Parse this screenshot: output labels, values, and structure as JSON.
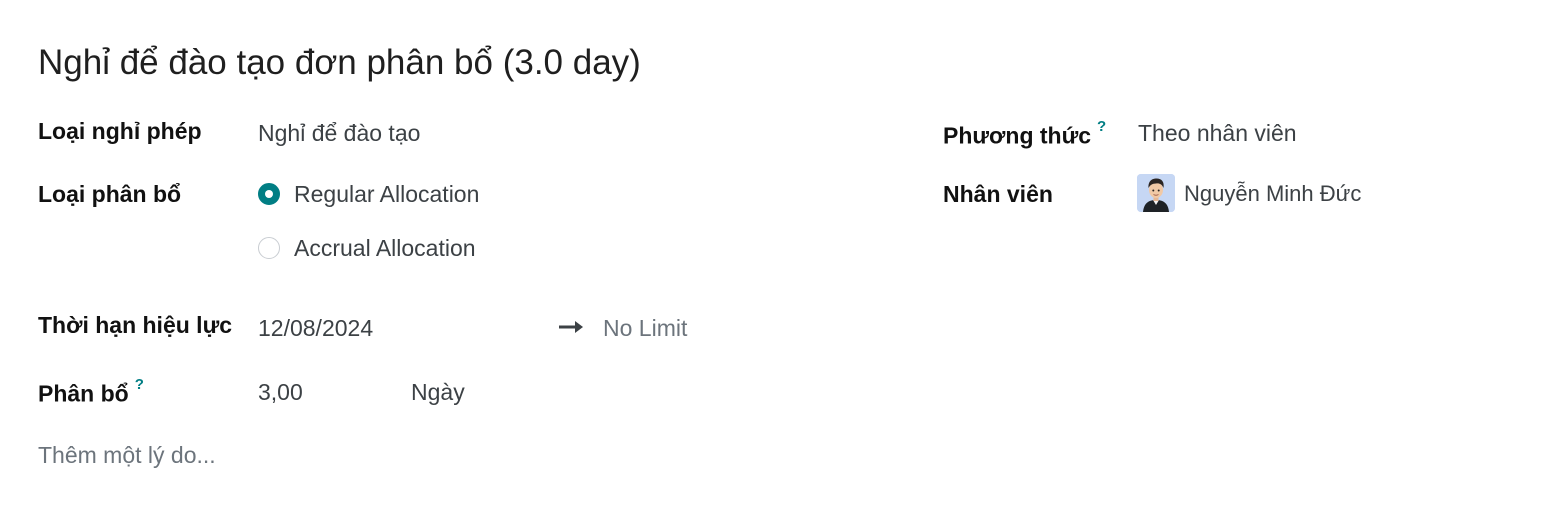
{
  "title": "Nghỉ để đào tạo đơn phân bổ (3.0 day)",
  "left": {
    "leave_type_label": "Loại nghỉ phép",
    "leave_type_value": "Nghỉ để đào tạo",
    "allocation_type_label": "Loại phân bổ",
    "allocation_options": [
      {
        "label": "Regular Allocation",
        "selected": true
      },
      {
        "label": "Accrual Allocation",
        "selected": false
      }
    ],
    "validity_label": "Thời hạn hiệu lực",
    "validity_start": "12/08/2024",
    "validity_end": "No Limit",
    "allocation_label": "Phân bổ",
    "allocation_help": "?",
    "allocation_value": "3,00",
    "allocation_unit": "Ngày",
    "reason_placeholder": "Thêm một lý do..."
  },
  "right": {
    "mode_label": "Phương thức",
    "mode_help": "?",
    "mode_value": "Theo nhân viên",
    "employee_label": "Nhân viên",
    "employee_name": "Nguyễn Minh Đức"
  },
  "icons": {
    "arrow": "arrow-right-icon",
    "avatar": "employee-avatar"
  },
  "colors": {
    "accent": "#017e84",
    "text": "#3c4145",
    "label": "#111111",
    "placeholder": "#6c747c"
  }
}
